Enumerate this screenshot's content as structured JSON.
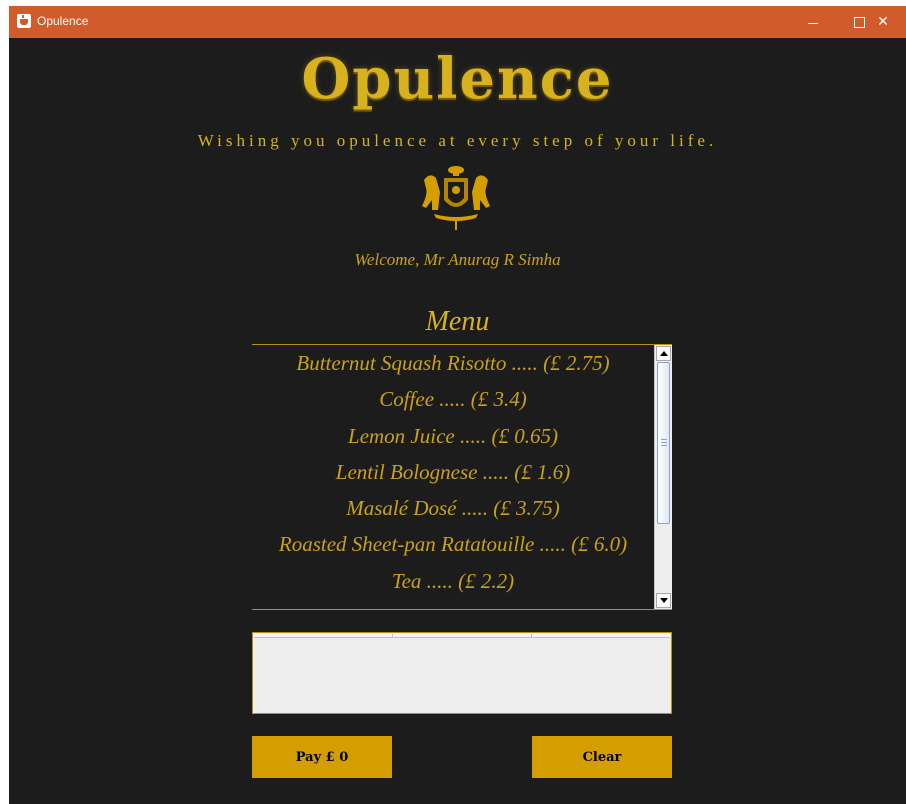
{
  "window": {
    "title": "Opulence",
    "controls": {
      "minimize": "–",
      "maximize": "",
      "close": "✕"
    }
  },
  "header": {
    "logo_text": "Opulence",
    "tagline": "Wishing you opulence at every step of your life.",
    "crest_icon": "royal-crest-icon"
  },
  "welcome": {
    "text": "Welcome, Mr Anurag R Simha"
  },
  "menu": {
    "title": "Menu",
    "items": [
      "Butternut Squash Risotto ..... (£ 2.75)",
      "Coffee ..... (£ 3.4)",
      "Lemon Juice ..... (£ 0.65)",
      "Lentil Bolognese ..... (£ 1.6)",
      "Masalé Dosé ..... (£ 3.75)",
      "Roasted Sheet-pan Ratatouille ..... (£ 6.0)",
      "Tea ..... (£ 2.2)"
    ],
    "scroll_position": 0.0
  },
  "order_table": {
    "columns": [
      "",
      "",
      ""
    ],
    "rows": []
  },
  "actions": {
    "pay_label": "Pay £ 0",
    "clear_label": "Clear"
  },
  "colors": {
    "titlebar": "#d15b2a",
    "background": "#1c1c1c",
    "gold": "#d8b21e",
    "button": "#d49e00"
  }
}
